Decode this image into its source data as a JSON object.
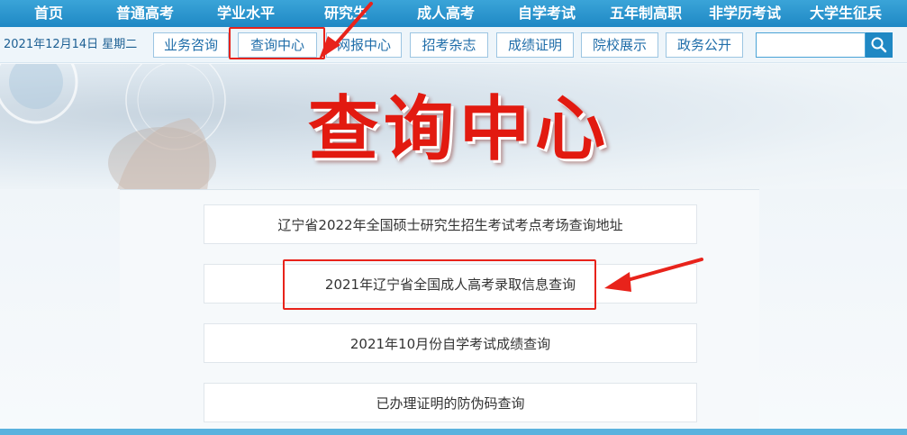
{
  "topnav": {
    "items": [
      "首页",
      "普通高考",
      "学业水平",
      "研究生",
      "成人高考",
      "自学考试",
      "五年制高职",
      "非学历考试",
      "大学生征兵"
    ]
  },
  "subbar": {
    "date": "2021年12月14日 星期二",
    "tabs": [
      "业务咨询",
      "查询中心",
      "网报中心",
      "招考杂志",
      "成绩证明",
      "院校展示",
      "政务公开"
    ],
    "active_tab": "查询中心",
    "search": {
      "value": "",
      "placeholder": ""
    }
  },
  "banner": {
    "title": "查询中心"
  },
  "queries": [
    "辽宁省2022年全国硕士研究生招生考试考点考场查询地址",
    "2021年辽宁省全国成人高考录取信息查询",
    "2021年10月份自学考试成绩查询",
    "已办理证明的防伪码查询"
  ],
  "colors": {
    "nav_bg": "#1f88c4",
    "tab_text": "#1f6da9",
    "title_red": "#e21a10",
    "annotation_red": "#e8231b"
  },
  "icons": {
    "search": "search-icon"
  }
}
